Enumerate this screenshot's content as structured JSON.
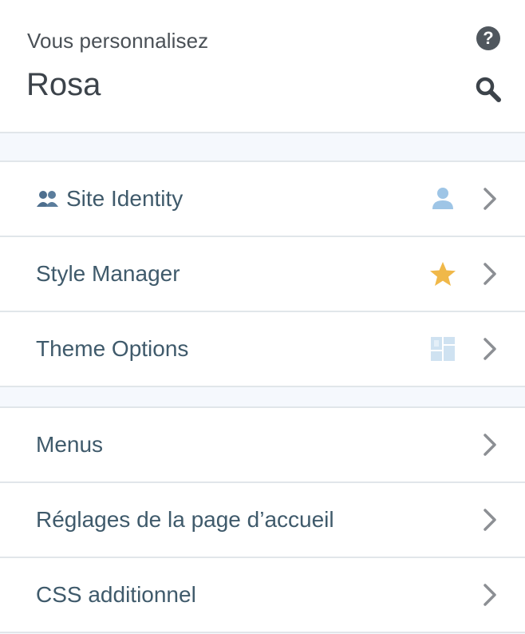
{
  "header": {
    "subtitle": "Vous personnalisez",
    "title": "Rosa",
    "help_icon": "help-icon",
    "search_icon": "search-icon"
  },
  "sections": [
    {
      "items": [
        {
          "label": "Site Identity",
          "prefix_icon": "users-emoji-icon",
          "badge_icon": "user-icon",
          "badge_color": "#9ec5e6"
        },
        {
          "label": "Style Manager",
          "badge_icon": "star-icon",
          "badge_color": "#f0b849"
        },
        {
          "label": "Theme Options",
          "badge_icon": "layout-grid-icon",
          "badge_color": "#cfe2f1"
        }
      ]
    },
    {
      "items": [
        {
          "label": "Menus"
        },
        {
          "label": "Réglages de la page d’accueil"
        },
        {
          "label": "CSS additionnel"
        }
      ]
    }
  ]
}
